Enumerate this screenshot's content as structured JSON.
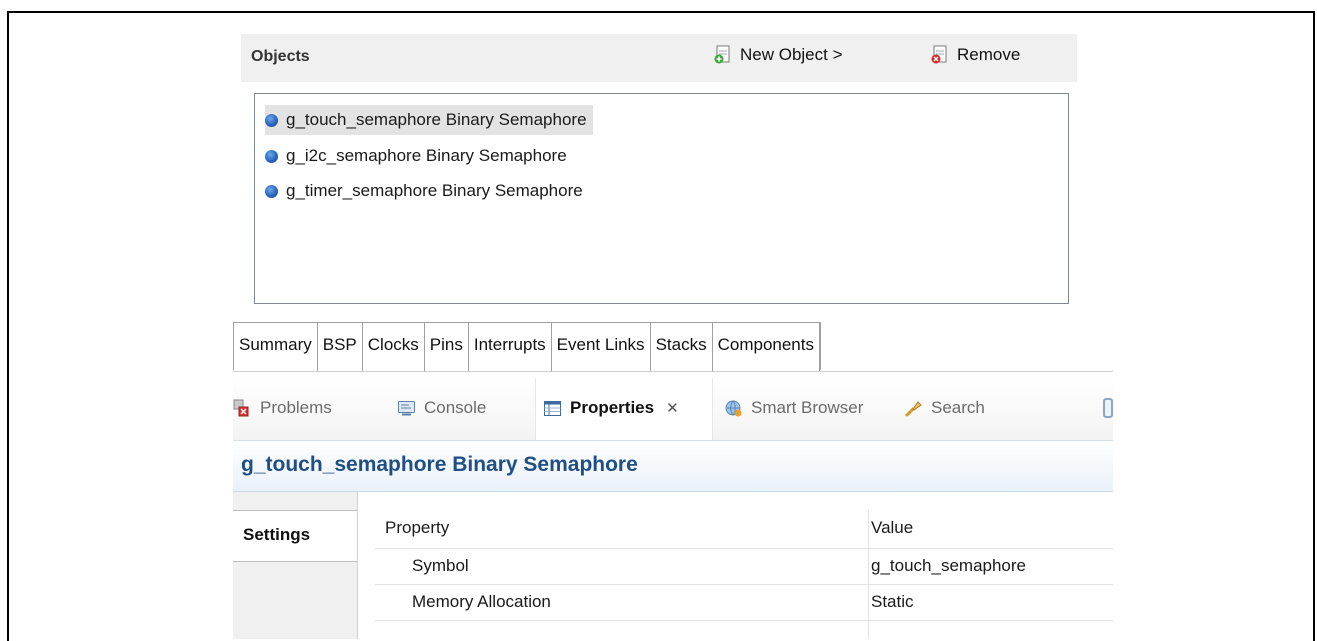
{
  "objects_panel": {
    "title": "Objects",
    "new_object_label": "New Object >",
    "remove_label": "Remove",
    "items": [
      {
        "label": "g_touch_semaphore Binary Semaphore",
        "selected": true
      },
      {
        "label": "g_i2c_semaphore Binary Semaphore",
        "selected": false
      },
      {
        "label": "g_timer_semaphore Binary Semaphore",
        "selected": false
      }
    ]
  },
  "config_tabs": [
    "Summary",
    "BSP",
    "Clocks",
    "Pins",
    "Interrupts",
    "Event Links",
    "Stacks",
    "Components"
  ],
  "config_tabs_active": "Stacks",
  "view_tabs": [
    {
      "label": "Problems",
      "icon": "problems-icon",
      "active": false
    },
    {
      "label": "Console",
      "icon": "console-icon",
      "active": false
    },
    {
      "label": "Properties",
      "icon": "properties-icon",
      "active": true
    },
    {
      "label": "Smart Browser",
      "icon": "smart-browser-icon",
      "active": false
    },
    {
      "label": "Search",
      "icon": "search-icon",
      "active": false
    }
  ],
  "properties_title": "g_touch_semaphore Binary Semaphore",
  "side_tabs": [
    "Settings"
  ],
  "property_table": {
    "headers": {
      "property": "Property",
      "value": "Value"
    },
    "rows": [
      {
        "property": "Symbol",
        "value": "g_touch_semaphore"
      },
      {
        "property": "Memory Allocation",
        "value": "Static"
      }
    ]
  },
  "colors": {
    "title": "#1f4f85",
    "bullet": "#2460b8",
    "selection": "#e3e3e3"
  }
}
